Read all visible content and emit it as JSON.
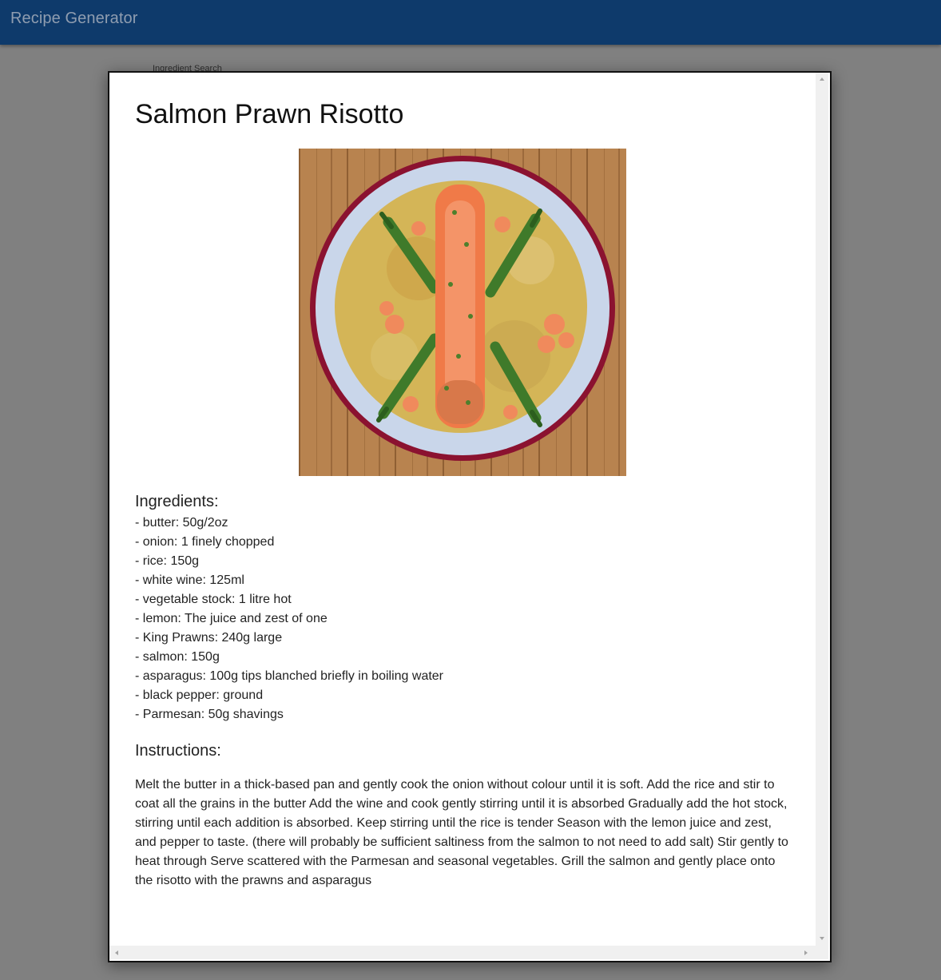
{
  "appbar": {
    "title": "Recipe Generator"
  },
  "background": {
    "search_label": "Ingredient Search"
  },
  "recipe": {
    "title": "Salmon Prawn Risotto",
    "ingredients_heading": "Ingredients:",
    "ingredients": [
      "- butter: 50g/2oz",
      "- onion: 1 finely chopped",
      "- rice: 150g",
      "- white wine: 125ml",
      "- vegetable stock: 1 litre hot",
      "- lemon: The juice and zest of one",
      "- King Prawns: 240g large",
      "- salmon: 150g",
      "- asparagus: 100g tips blanched briefly in boiling water",
      "- black pepper: ground",
      "- Parmesan: 50g shavings"
    ],
    "instructions_heading": "Instructions:",
    "instructions": "Melt the butter in a thick-based pan and gently cook the onion without colour until it is soft. Add the rice and stir to coat all the grains in the butter Add the wine and cook gently stirring until it is absorbed Gradually add the hot stock, stirring until each addition is absorbed. Keep stirring until the rice is tender Season with the lemon juice and zest, and pepper to taste. (there will probably be sufficient saltiness from the salmon to not need to add salt) Stir gently to heat through Serve scattered with the Parmesan and seasonal vegetables. Grill the salmon and gently place onto the risotto with the prawns and asparagus"
  },
  "colors": {
    "appbar": "#0e3a6b",
    "overlay": "#808080",
    "dialog": "#ffffff"
  }
}
